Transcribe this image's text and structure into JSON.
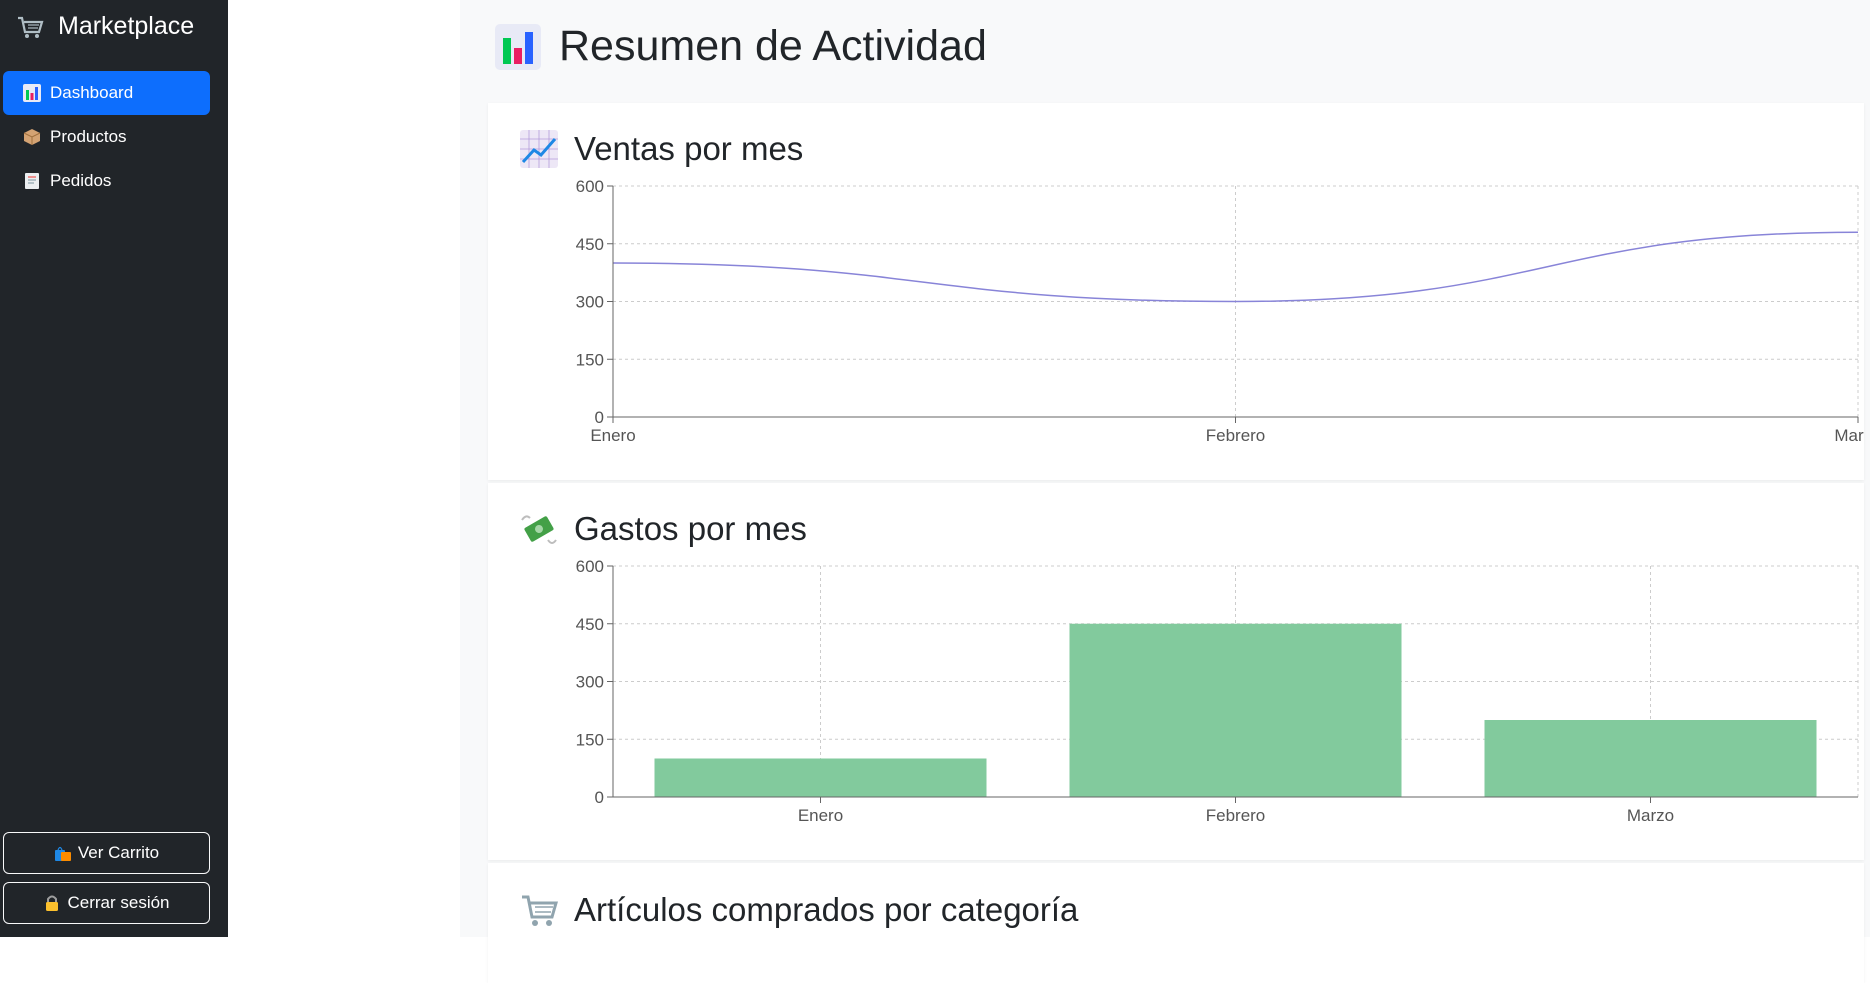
{
  "sidebar": {
    "brand": "Marketplace",
    "items": [
      {
        "label": "Dashboard",
        "active": true
      },
      {
        "label": "Productos",
        "active": false
      },
      {
        "label": "Pedidos",
        "active": false
      }
    ],
    "cart_button": "Ver Carrito",
    "logout_button": "Cerrar sesión"
  },
  "main": {
    "title": "Resumen de Actividad",
    "cards": [
      {
        "title": "Ventas por mes",
        "icon": "chart-increasing-icon"
      },
      {
        "title": "Gastos por mes",
        "icon": "money-with-wings-icon"
      },
      {
        "title": "Artículos comprados por categoría",
        "icon": "shopping-cart-icon"
      }
    ]
  },
  "colors": {
    "sidebar_bg": "#212529",
    "accent": "#0d6efd",
    "line_series": "#8884d8",
    "bar_series": "#82ca9d"
  },
  "chart_data": [
    {
      "type": "line",
      "categories": [
        "Enero",
        "Febrero",
        "Marzo"
      ],
      "values": [
        400,
        300,
        480
      ],
      "yticks": [
        0,
        150,
        300,
        450,
        600
      ],
      "ylim": [
        0,
        600
      ],
      "grid": true
    },
    {
      "type": "bar",
      "categories": [
        "Enero",
        "Febrero",
        "Marzo"
      ],
      "values": [
        100,
        450,
        200
      ],
      "yticks": [
        0,
        150,
        300,
        450,
        600
      ],
      "ylim": [
        0,
        600
      ],
      "grid": true
    }
  ]
}
